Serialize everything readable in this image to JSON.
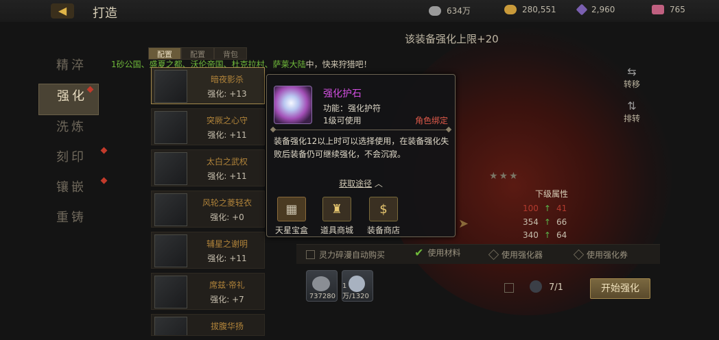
{
  "header": {
    "title": "打造"
  },
  "resources": [
    {
      "icon": "silver-coin-icon",
      "value": "634万"
    },
    {
      "icon": "gold-coin-icon",
      "value": "280,551"
    },
    {
      "icon": "diamond-icon",
      "value": "2,960"
    },
    {
      "icon": "gift-icon",
      "value": "765"
    }
  ],
  "side_menu": [
    {
      "label": "精淬",
      "active": false,
      "alert": false
    },
    {
      "label": "强化",
      "active": true,
      "alert": true
    },
    {
      "label": "洗炼",
      "active": false,
      "alert": false
    },
    {
      "label": "刻印",
      "active": false,
      "alert": true
    },
    {
      "label": "镶嵌",
      "active": false,
      "alert": true
    },
    {
      "label": "重铸",
      "active": false,
      "alert": false
    }
  ],
  "tabs": [
    "配置",
    "配置",
    "背包"
  ],
  "marquee": {
    "highlighted": "1砂公国、盛夏之都、沃伦帝国、杜克拉村、萨莱大陆",
    "rest": "中，快来狩猎吧！"
  },
  "equipment_list": [
    {
      "name": "暗夜影杀",
      "stat": "强化: +13",
      "badge": "+13"
    },
    {
      "name": "突厥之心守",
      "stat": "强化: +11",
      "badge": "+11"
    },
    {
      "name": "太白之武权",
      "stat": "强化: +11",
      "badge": "+11"
    },
    {
      "name": "风轮之菱轻衣",
      "stat": "强化: +0",
      "badge": ""
    },
    {
      "name": "辅星之谢明",
      "stat": "强化: +11",
      "badge": "+11"
    },
    {
      "name": "席兹·帝礼",
      "stat": "强化: +7",
      "badge": "+7"
    },
    {
      "name": "拔腹华扬",
      "stat": "",
      "badge": ""
    }
  ],
  "panel": {
    "limit_text": "该装备强化上限+20",
    "transfer_label": "转移",
    "shift_label": "排转",
    "next_attr_title": "下级属性",
    "attrs": [
      {
        "cur": "100",
        "next": "41",
        "dim": true
      },
      {
        "cur": "354",
        "next": "66",
        "dim": false
      },
      {
        "cur": "340",
        "next": "64",
        "dim": false
      }
    ]
  },
  "options": {
    "auto_buy": "灵力碎漫自动购买",
    "use_material": "使用材料",
    "use_enhancer": "使用强化器",
    "use_ticket": "使用强化券"
  },
  "materials": [
    {
      "icon": "stone-icon",
      "qty": "737280"
    },
    {
      "icon": "gem-icon",
      "qty": "1万/1320"
    }
  ],
  "enhance": {
    "count": "7/1",
    "start_label": "开始强化"
  },
  "tooltip": {
    "name": "强化护石",
    "function": "功能：强化护符",
    "level": "1级可使用",
    "bind": "角色绑定",
    "description": "装备强化12以上时可以选择使用，在装备强化失败后装备仍可继续强化，不会沉寂。",
    "source_title": "获取途径",
    "sources": [
      {
        "label": "天星宝盒",
        "icon": "treasure-box-icon"
      },
      {
        "label": "道具商城",
        "icon": "item-shop-icon"
      },
      {
        "label": "装备商店",
        "icon": "money-bag-icon"
      }
    ]
  }
}
